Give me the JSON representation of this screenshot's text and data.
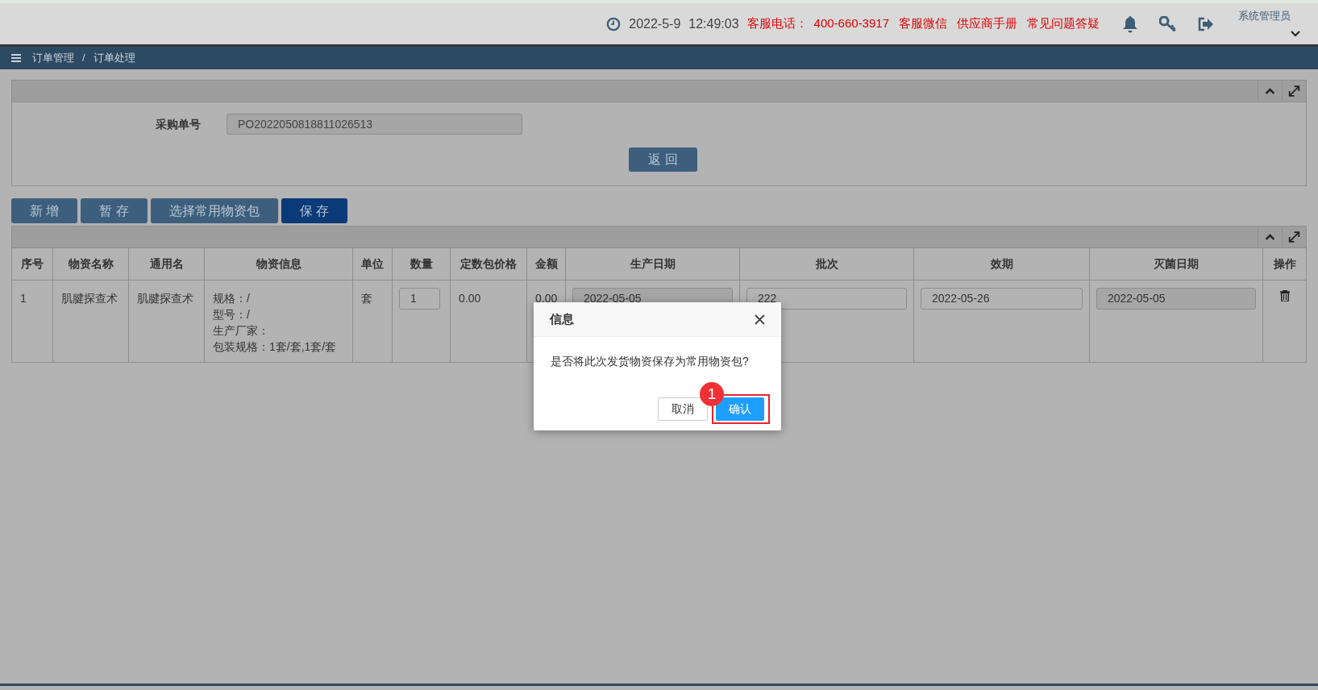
{
  "top_bar": {
    "date": "2022-5-9",
    "time": "12:49:03",
    "links": [
      "客服电话：",
      "400-660-3917",
      "客服微信",
      "供应商手册",
      "常见问题答疑"
    ],
    "user": "系统管理员"
  },
  "breadcrumb": {
    "items": [
      "订单管理",
      "订单处理"
    ],
    "separator": "/"
  },
  "search_panel": {
    "label": "采购单号",
    "value": "PO2022050818811026513",
    "back_button": "返 回"
  },
  "toolbar": [
    {
      "label": "新 增",
      "primary": false
    },
    {
      "label": "暂 存",
      "primary": false
    },
    {
      "label": "选择常用物资包",
      "primary": false
    },
    {
      "label": "保 存",
      "primary": true
    }
  ],
  "table": {
    "columns": [
      "序号",
      "物资名称",
      "通用名",
      "物资信息",
      "单位",
      "数量",
      "定数包价格",
      "金额",
      "生产日期",
      "批次",
      "效期",
      "灭菌日期",
      "操作"
    ],
    "rows": [
      {
        "cells": [
          {
            "kind": "text",
            "text": "1"
          },
          {
            "kind": "text",
            "text": "肌腱探查术"
          },
          {
            "kind": "text",
            "text": "肌腱探查术"
          },
          {
            "kind": "lines",
            "lines": [
              "规格：/",
              "型号：/",
              "生产厂家：",
              "包装规格：1套/套,1套/套"
            ]
          },
          {
            "kind": "text",
            "text": "套"
          },
          {
            "kind": "input",
            "value": "1",
            "readonly": false
          },
          {
            "kind": "text",
            "text": "0.00"
          },
          {
            "kind": "text",
            "text": "0.00"
          },
          {
            "kind": "input",
            "value": "2022-05-05",
            "readonly": true
          },
          {
            "kind": "input",
            "value": "222",
            "readonly": false
          },
          {
            "kind": "input",
            "value": "2022-05-26",
            "readonly": false
          },
          {
            "kind": "input",
            "value": "2022-05-05",
            "readonly": true
          },
          {
            "kind": "delete"
          }
        ]
      }
    ]
  },
  "dialog": {
    "title": "信息",
    "message": "是否将此次发货物资保存为常用物资包?",
    "buttons": [
      {
        "label": "取消",
        "primary": false
      },
      {
        "label": "确认",
        "primary": true,
        "badge": "1"
      }
    ]
  }
}
